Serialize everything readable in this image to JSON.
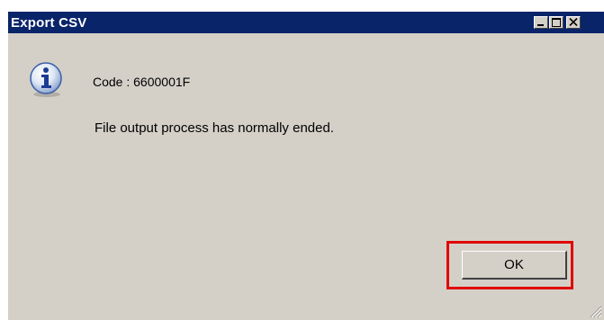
{
  "window": {
    "title": "Export CSV"
  },
  "message": {
    "code": "Code : 6600001F",
    "text": "File output process has normally ended.",
    "icon": "info-icon"
  },
  "buttons": {
    "ok_label": "OK"
  },
  "colors": {
    "titlebar": "#0a246a",
    "dialog_bg": "#d4d0c8",
    "highlight": "#e00000"
  }
}
